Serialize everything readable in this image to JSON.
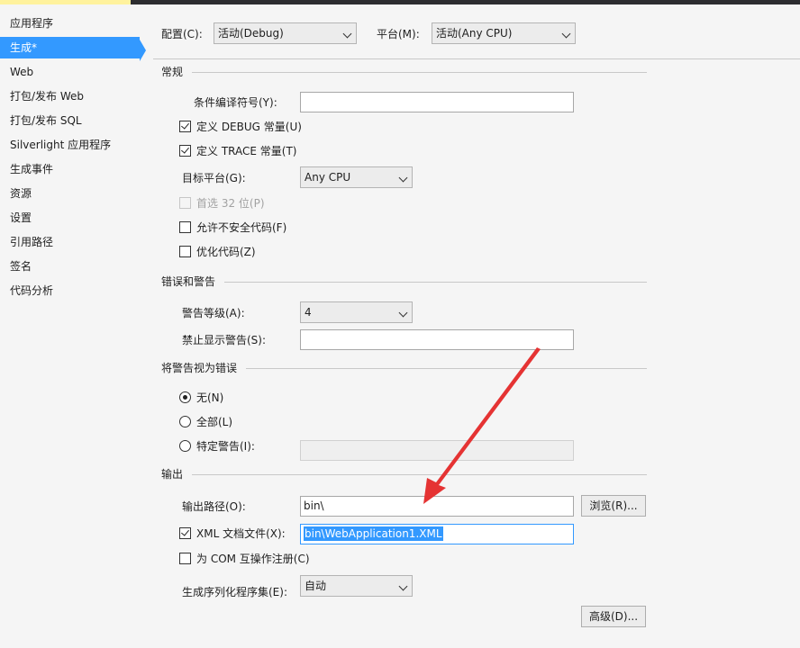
{
  "colors": {
    "accent": "#3399ff",
    "annotation_arrow": "#e53333",
    "tab_active": "#fff29d"
  },
  "sidebar": {
    "items": [
      {
        "label": "应用程序",
        "selected": false
      },
      {
        "label": "生成*",
        "selected": true
      },
      {
        "label": "Web",
        "selected": false
      },
      {
        "label": "打包/发布 Web",
        "selected": false
      },
      {
        "label": "打包/发布 SQL",
        "selected": false
      },
      {
        "label": "Silverlight 应用程序",
        "selected": false
      },
      {
        "label": "生成事件",
        "selected": false
      },
      {
        "label": "资源",
        "selected": false
      },
      {
        "label": "设置",
        "selected": false
      },
      {
        "label": "引用路径",
        "selected": false
      },
      {
        "label": "签名",
        "selected": false
      },
      {
        "label": "代码分析",
        "selected": false
      }
    ]
  },
  "config": {
    "configuration_label": "配置(C):",
    "configuration_value": "活动(Debug)",
    "platform_label": "平台(M):",
    "platform_value": "活动(Any CPU)"
  },
  "general": {
    "title": "常规",
    "conditional_symbols_label": "条件编译符号(Y):",
    "conditional_symbols_value": "",
    "define_debug": {
      "label": "定义 DEBUG 常量(U)",
      "checked": true
    },
    "define_trace": {
      "label": "定义 TRACE 常量(T)",
      "checked": true
    },
    "target_platform_label": "目标平台(G):",
    "target_platform_value": "Any CPU",
    "prefer32": {
      "label": "首选 32 位(P)",
      "checked": false,
      "disabled": true
    },
    "allow_unsafe": {
      "label": "允许不安全代码(F)",
      "checked": false
    },
    "optimize": {
      "label": "优化代码(Z)",
      "checked": false
    }
  },
  "errors": {
    "title": "错误和警告",
    "warning_level_label": "警告等级(A):",
    "warning_level_value": "4",
    "suppress_label": "禁止显示警告(S):",
    "suppress_value": ""
  },
  "treat_warnings": {
    "title": "将警告视为错误",
    "options": [
      {
        "label": "无(N)",
        "selected": true
      },
      {
        "label": "全部(L)",
        "selected": false
      },
      {
        "label": "特定警告(I):",
        "selected": false
      }
    ],
    "specific_value": ""
  },
  "output": {
    "title": "输出",
    "path_label": "输出路径(O):",
    "path_value": "bin\\",
    "browse_label": "浏览(R)...",
    "xml_doc": {
      "label": "XML 文档文件(X):",
      "checked": true,
      "value": "bin\\WebApplication1.XML"
    },
    "com_register": {
      "label": "为 COM 互操作注册(C)",
      "checked": false
    },
    "serialization_label": "生成序列化程序集(E):",
    "serialization_value": "自动",
    "advanced_label": "高级(D)..."
  }
}
